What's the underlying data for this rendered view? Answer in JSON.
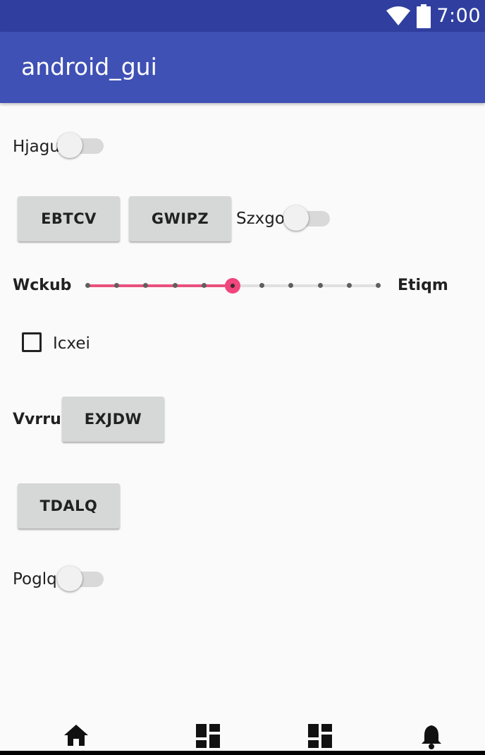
{
  "status_bar": {
    "time": "7:00",
    "icons": [
      "wifi-icon",
      "battery-icon"
    ]
  },
  "app_bar": {
    "title": "android_gui",
    "color": "#3f51b5",
    "status_color": "#303f9f"
  },
  "rows": {
    "switch_1": {
      "label": "Hjagu",
      "checked": false
    },
    "buttons_row": {
      "button_1": "EBTCV",
      "button_2": "GWIPZ",
      "switch_label": "Szxgo",
      "switch_checked": false
    },
    "slider": {
      "label_left": "Wckub",
      "label_right": "Etiqm",
      "min": 0,
      "max": 10,
      "value": 5,
      "accent": "#f0457d"
    },
    "checkbox": {
      "label": "Icxei",
      "checked": false
    },
    "labeled_button": {
      "label": "Vvrru",
      "button": "EXJDW"
    },
    "single_button": {
      "label": "TDALQ"
    },
    "switch_2": {
      "label": "Poglq",
      "checked": false
    }
  },
  "bottom_nav": {
    "items": [
      "home-icon",
      "dashboard-icon",
      "dashboard-icon",
      "notifications-icon"
    ]
  }
}
